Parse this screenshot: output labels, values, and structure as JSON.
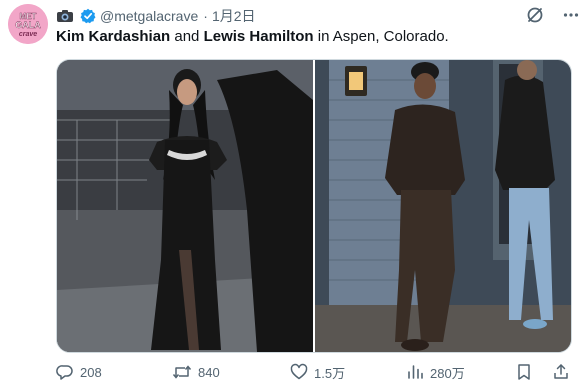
{
  "avatar": {
    "lines": [
      "MET",
      "GALA",
      "crave"
    ],
    "bg": "#f2a6c8"
  },
  "header": {
    "handle": "@metgalacrave",
    "separator": "·",
    "date": "1月2日",
    "icons": [
      "camera-emoji-icon",
      "verified-icon",
      "grok-icon",
      "more-icon"
    ]
  },
  "tweet": {
    "name1": "Kim Kardashian",
    "conj": " and ",
    "name2": "Lewis Hamilton",
    "rest": " in Aspen, Colorado."
  },
  "media": {
    "photos": [
      {
        "subject": "woman in black sequined dress walking at night"
      },
      {
        "subject": "man in brown jacket and pants walking past wooden house"
      }
    ]
  },
  "actions": {
    "replies": "208",
    "reposts": "840",
    "likes": "1.5万",
    "views": "280万"
  },
  "colors": {
    "text": "#0f1419",
    "muted": "#536471",
    "verified": "#1d9bf0",
    "border": "#cfd9de"
  }
}
